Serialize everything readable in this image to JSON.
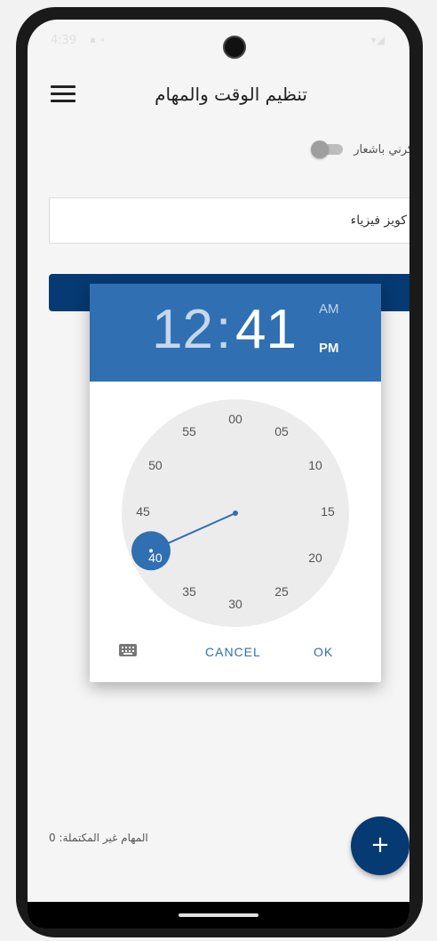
{
  "status_bar": {
    "time": "4:39",
    "left_icons": "▪ ⚬",
    "right_icons": "▾◢"
  },
  "header": {
    "title": "تنظيم الوقت والمهام"
  },
  "reminder": {
    "label": "ذكرني باشعار",
    "enabled": false
  },
  "task_input": {
    "value": "كويز فيزياء"
  },
  "time_picker": {
    "hour": "12",
    "separator": ":",
    "minute": "41",
    "am_label": "AM",
    "pm_label": "PM",
    "selected_period": "PM",
    "dial_numbers": [
      "00",
      "05",
      "10",
      "15",
      "20",
      "25",
      "30",
      "35",
      "40",
      "45",
      "50",
      "55"
    ],
    "selected_dial_value": "40",
    "hand_minute": 41,
    "cancel_label": "CANCEL",
    "ok_label": "OK"
  },
  "footer": {
    "incomplete_tasks": "المهام غير المكتملة: 0"
  },
  "fab": {
    "label": "+"
  },
  "colors": {
    "primary": "#063a72",
    "dialog_header": "#2f6fb2",
    "dial_bg": "#ececec"
  }
}
